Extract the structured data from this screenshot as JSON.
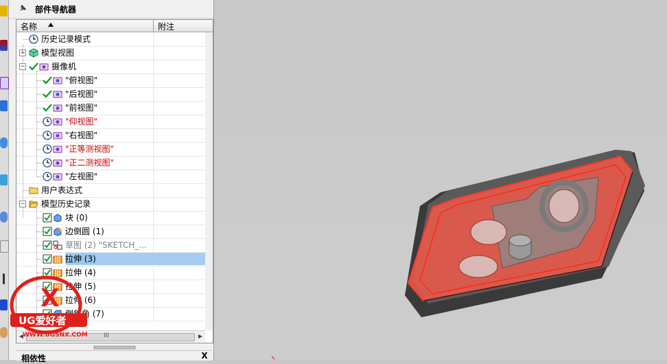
{
  "navigator": {
    "title": "部件导航器",
    "columns": {
      "name": "名称",
      "note": "附注"
    },
    "rows": [
      {
        "label": "历史记录模式",
        "color": "normal"
      },
      {
        "label": "模型视图",
        "color": "normal"
      },
      {
        "label": "摄像机",
        "color": "normal"
      },
      {
        "label": "\"俯视图\"",
        "color": "normal"
      },
      {
        "label": "\"后视图\"",
        "color": "normal"
      },
      {
        "label": "\"前视图\"",
        "color": "normal"
      },
      {
        "label": "\"仰视图\"",
        "color": "red"
      },
      {
        "label": "\"右视图\"",
        "color": "normal"
      },
      {
        "label": "\"正等测视图\"",
        "color": "red"
      },
      {
        "label": "\"正二测视图\"",
        "color": "red"
      },
      {
        "label": "\"左视图\"",
        "color": "normal"
      },
      {
        "label": "用户表达式",
        "color": "normal"
      },
      {
        "label": "模型历史记录",
        "color": "normal"
      },
      {
        "label": "块 (0)",
        "color": "normal"
      },
      {
        "label": "边倒圆 (1)",
        "color": "normal"
      },
      {
        "label": "草图 (2) \"SKETCH_...",
        "color": "gray"
      },
      {
        "label": "拉伸 (3)",
        "color": "normal"
      },
      {
        "label": "拉伸 (4)",
        "color": "normal"
      },
      {
        "label": "拉伸 (5)",
        "color": "normal"
      },
      {
        "label": "拉伸 (6)",
        "color": "normal"
      },
      {
        "label": "倒斜角 (7)",
        "color": "normal"
      }
    ],
    "hscroll_grip": "III"
  },
  "bottom_panel": {
    "title": "相依性",
    "close": "X"
  },
  "watermark": {
    "brand": "UG爱好者",
    "url": "WWW.UGSNX.COM",
    "mark": "X"
  },
  "colors": {
    "selection": "#a6cdf0",
    "red_text": "#c00000",
    "model_red": "#f05a4a",
    "model_dark": "#3a3a3a"
  }
}
